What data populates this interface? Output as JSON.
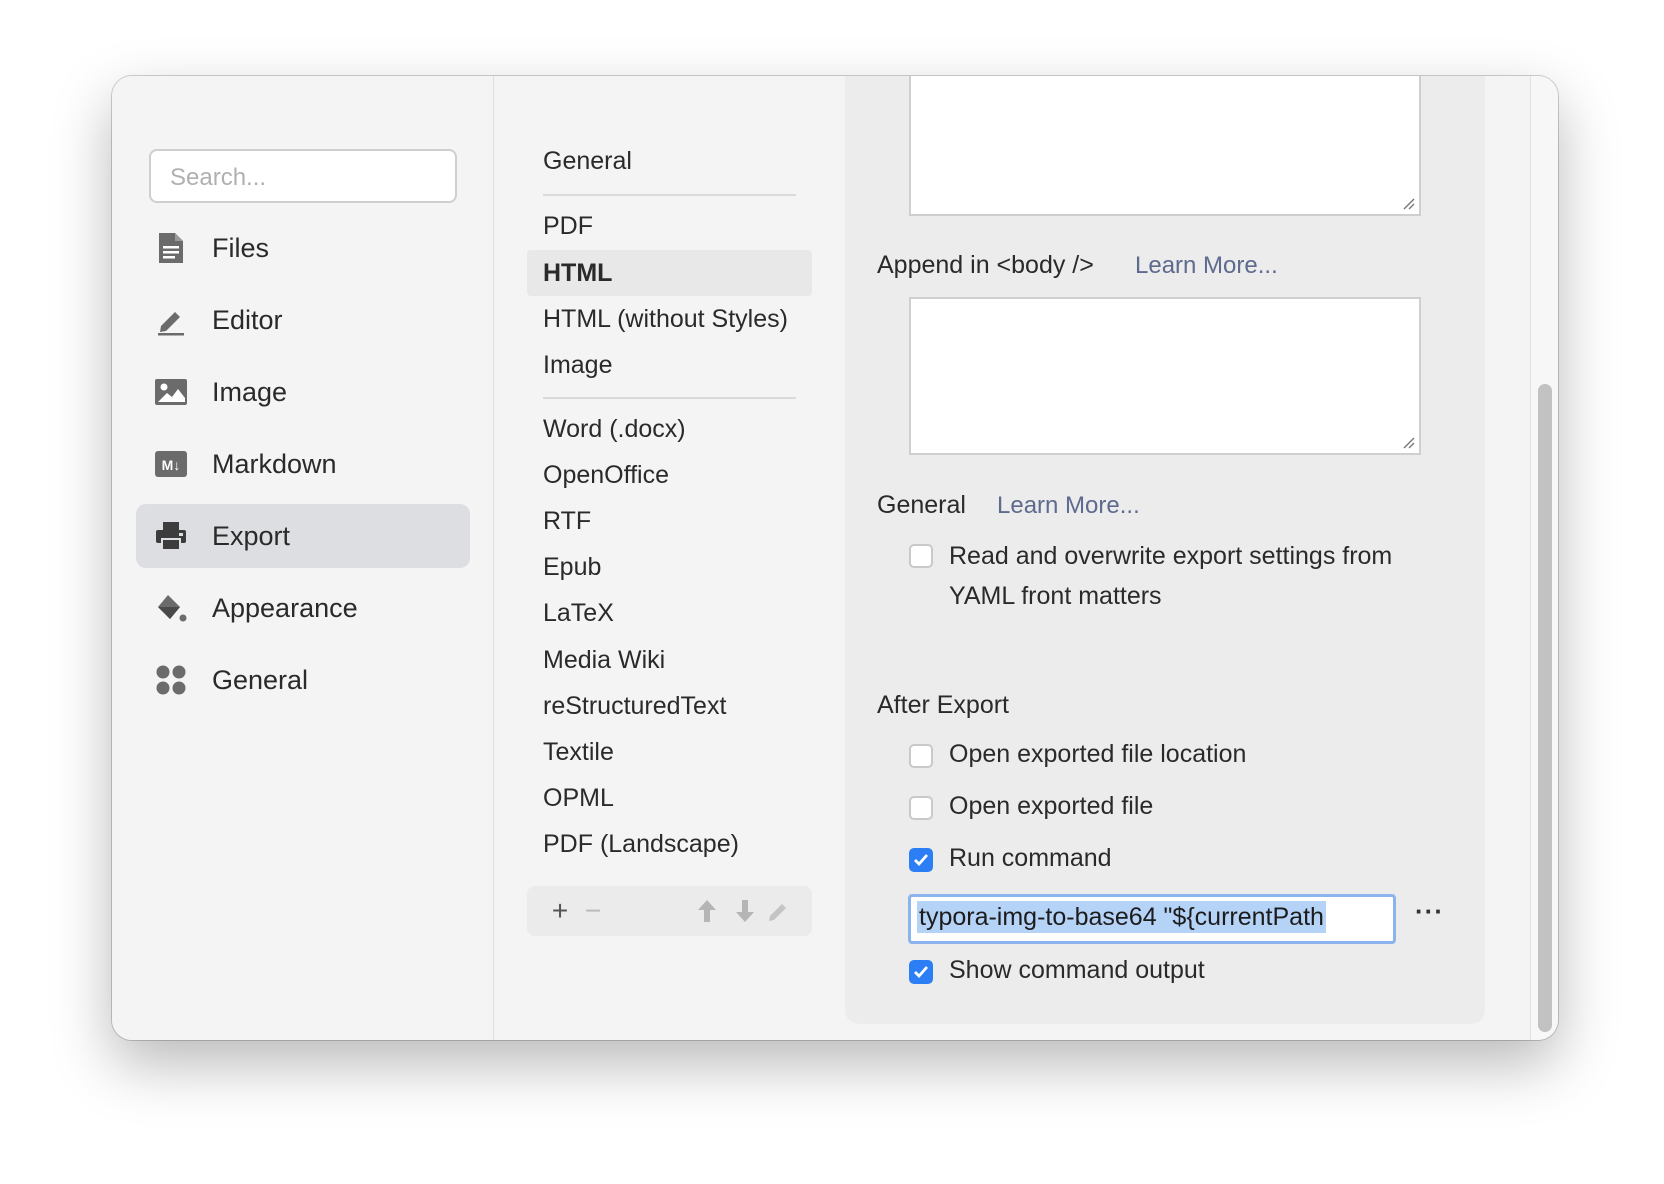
{
  "search": {
    "placeholder": "Search..."
  },
  "sidebar": {
    "items": [
      {
        "label": "Files",
        "icon": "file-icon"
      },
      {
        "label": "Editor",
        "icon": "pencil-icon"
      },
      {
        "label": "Image",
        "icon": "image-icon"
      },
      {
        "label": "Markdown",
        "icon": "markdown-icon"
      },
      {
        "label": "Export",
        "icon": "printer-icon",
        "active": true
      },
      {
        "label": "Appearance",
        "icon": "paint-bucket-icon"
      },
      {
        "label": "General",
        "icon": "grid-icon"
      }
    ]
  },
  "formats": {
    "items": [
      "General",
      "PDF",
      "HTML",
      "HTML (without Styles)",
      "Image",
      "Word (.docx)",
      "OpenOffice",
      "RTF",
      "Epub",
      "LaTeX",
      "Media Wiki",
      "reStructuredText",
      "Textile",
      "OPML",
      "PDF (Landscape)"
    ],
    "selected": "HTML",
    "toolbar": {
      "add": "+",
      "remove": "−"
    }
  },
  "panel": {
    "append_body_label": "Append in <body />",
    "append_body_link": "Learn More...",
    "general_label": "General",
    "general_link": "Learn More...",
    "yaml_option": "Read and overwrite export settings from YAML front matters",
    "yaml_checked": false,
    "after_export_label": "After Export",
    "open_location": "Open exported file location",
    "open_location_checked": false,
    "open_file": "Open exported file",
    "open_file_checked": false,
    "run_command": "Run command",
    "run_command_checked": true,
    "command_value": "typora-img-to-base64 \"${currentPath",
    "more_label": "···",
    "show_output": "Show command output",
    "show_output_checked": true
  },
  "colors": {
    "accent": "#2c7ef4",
    "link": "#5e6a8e",
    "close": "#ed6a5e"
  }
}
